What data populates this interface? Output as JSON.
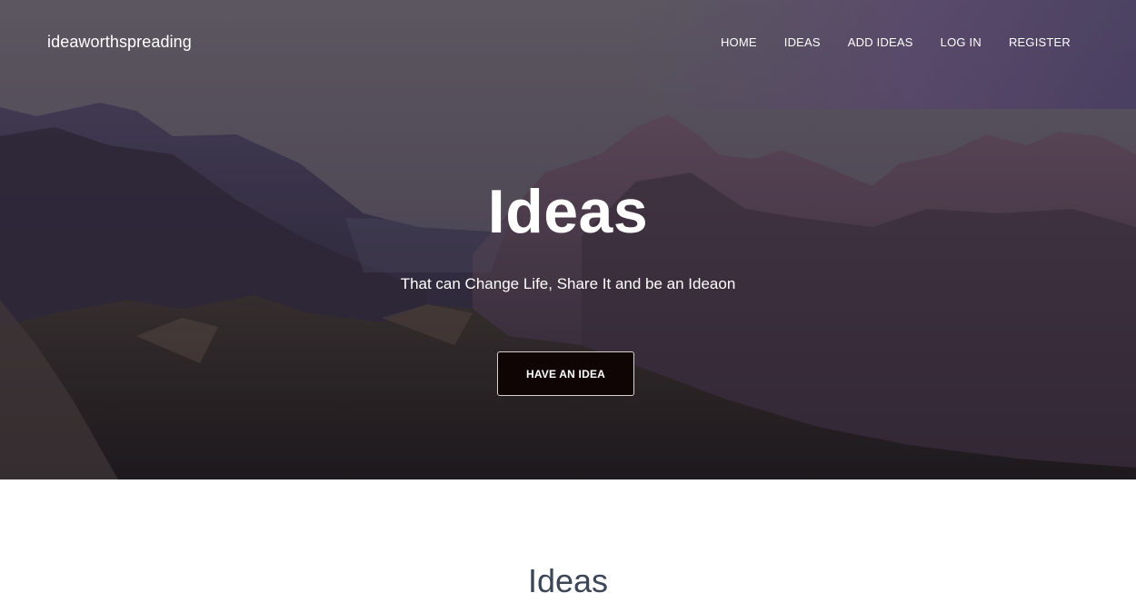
{
  "brand": {
    "name": "ideaworthspreading"
  },
  "nav": {
    "items": [
      {
        "label": "HOME"
      },
      {
        "label": "IDEAS"
      },
      {
        "label": "ADD IDEAS"
      },
      {
        "label": "LOG IN"
      },
      {
        "label": "REGISTER"
      }
    ]
  },
  "hero": {
    "title": "Ideas",
    "subtitle": "That can Change Life, Share It and be an Ideaon",
    "cta_label": "HAVE AN IDEA",
    "background_image": "mountain-landscape"
  },
  "section": {
    "title": "Ideas"
  },
  "colors": {
    "hero_overlay": "#3a3340",
    "cta_bg": "#0f0505",
    "section_title": "#3b4658",
    "nav_text": "#ffffff"
  }
}
